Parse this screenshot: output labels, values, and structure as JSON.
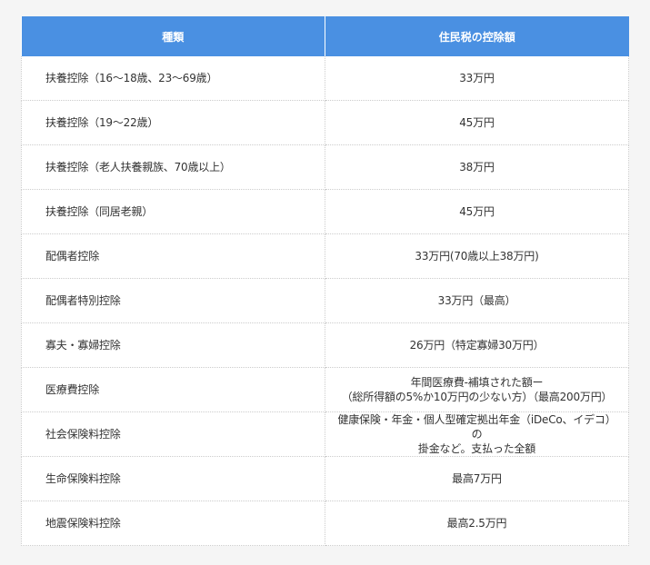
{
  "table": {
    "headers": {
      "type": "種類",
      "amount": "住民税の控除額"
    },
    "rows": [
      {
        "type": "扶養控除（16〜18歳、23〜69歳）",
        "amount": [
          "33万円"
        ]
      },
      {
        "type": "扶養控除（19〜22歳）",
        "amount": [
          "45万円"
        ]
      },
      {
        "type": "扶養控除（老人扶養親族、70歳以上）",
        "amount": [
          "38万円"
        ]
      },
      {
        "type": "扶養控除（同居老親）",
        "amount": [
          "45万円"
        ]
      },
      {
        "type": "配偶者控除",
        "amount": [
          "33万円(70歳以上38万円)"
        ]
      },
      {
        "type": "配偶者特別控除",
        "amount": [
          "33万円（最高）"
        ]
      },
      {
        "type": "寡夫・寡婦控除",
        "amount": [
          "26万円（特定寡婦30万円）"
        ]
      },
      {
        "type": "医療費控除",
        "amount": [
          "年間医療費-補填された額ー",
          "（総所得額の5%か10万円の少ない方）（最高200万円）"
        ]
      },
      {
        "type": "社会保険料控除",
        "amount": [
          "健康保険・年金・個人型確定拠出年金（iDeCo、イデコ）の",
          "掛金など。支払った全額"
        ]
      },
      {
        "type": "生命保険料控除",
        "amount": [
          "最高7万円"
        ]
      },
      {
        "type": "地震保険料控除",
        "amount": [
          "最高2.5万円"
        ]
      }
    ]
  },
  "colors": {
    "header_bg": "#4a90e2",
    "header_text": "#ffffff",
    "border": "#cccccc",
    "page_bg": "#f5f5f5"
  }
}
